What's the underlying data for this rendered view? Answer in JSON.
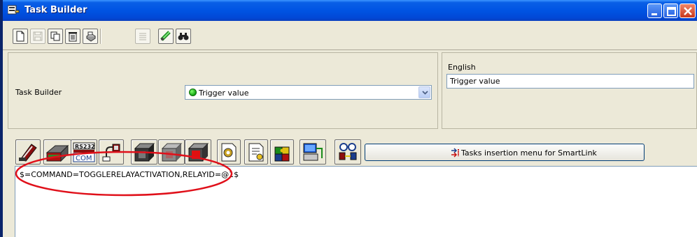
{
  "window": {
    "title": "Task Builder",
    "icons": [
      "app-icon",
      "minimize-icon",
      "maximize-icon",
      "close-icon"
    ]
  },
  "toolbar": {
    "buttons": [
      {
        "name": "new-document-icon",
        "enabled": true
      },
      {
        "name": "save-icon",
        "enabled": false
      },
      {
        "name": "copy-icon",
        "enabled": true
      },
      {
        "name": "delete-trash-icon",
        "enabled": true
      },
      {
        "name": "print-icon",
        "enabled": true
      },
      {
        "name": "list-icon",
        "enabled": false
      },
      {
        "name": "link-check-icon",
        "enabled": true
      },
      {
        "name": "find-binoculars-icon",
        "enabled": true
      }
    ]
  },
  "header": {
    "task_builder_label": "Task Builder",
    "trigger_select": {
      "value": "Trigger value",
      "status_color": "#1db31d"
    },
    "language_label": "English",
    "language_value": "Trigger value"
  },
  "task_toolbar": {
    "insertion_button_label": "Tasks insertion menu for SmartLink",
    "icons": [
      "ir-remote-icon",
      "rs232-device-icon",
      "rs232-com-icon",
      "network-plug-icon",
      "stop-black-icon",
      "stop-gray-icon",
      "stop-red-icon",
      "gear-document-icon",
      "document-arrow-icon",
      "puzzle-icon",
      "computer-network-icon",
      "camera-connection-icon"
    ],
    "rs232_text": "RS232",
    "com_text": "COM"
  },
  "editor": {
    "code": "$=COMMAND=TOGGLERELAYACTIVATION,RELAYID=@1$"
  },
  "colors": {
    "titlebar": "#0054e3",
    "annotation": "#e0101a",
    "window_bg": "#ece9d8"
  }
}
